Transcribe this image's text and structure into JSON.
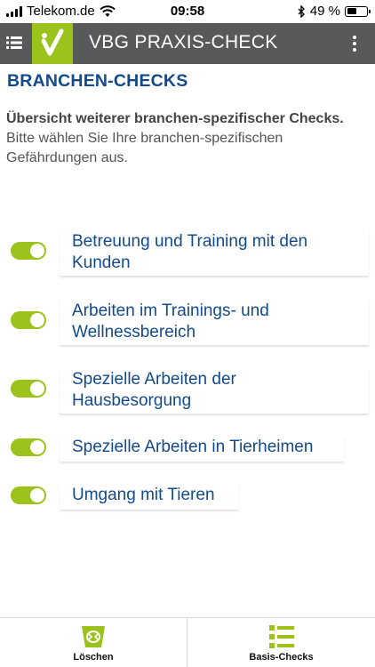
{
  "status_bar": {
    "carrier": "Telekom.de",
    "time": "09:58",
    "battery": "49 %",
    "battery_level": 0.49
  },
  "header": {
    "title": "VBG PRAXIS-CHECK",
    "menu_icon": "list-icon",
    "logo_icon": "checkmark-logo-icon",
    "more_icon": "more-vertical-icon"
  },
  "main": {
    "section_title": "BRANCHEN-CHECKS",
    "intro_bold": "Übersicht weiterer branchen-spezifischer Checks.",
    "intro_text": "Bitte wählen Sie Ihre branchen-spezifischen Gefährdungen aus.",
    "checks": [
      {
        "label": "Betreuung und Training mit den Kunden",
        "enabled": true
      },
      {
        "label": "Arbeiten im Trainings- und Wellnessbereich",
        "enabled": true
      },
      {
        "label": "Spezielle Arbeiten der Hausbesorgung",
        "enabled": true
      },
      {
        "label": "Spezielle Arbeiten in Tierheimen",
        "enabled": true
      },
      {
        "label": "Umgang mit Tieren",
        "enabled": true
      }
    ]
  },
  "tabbar": {
    "tabs": [
      {
        "label": "Löschen",
        "icon": "delete-bin-icon"
      },
      {
        "label": "Basis-Checks",
        "icon": "checklist-icon"
      }
    ]
  },
  "colors": {
    "accent_green": "#9bc31c",
    "header_gray": "#58595b",
    "link_blue": "#134a8c"
  }
}
